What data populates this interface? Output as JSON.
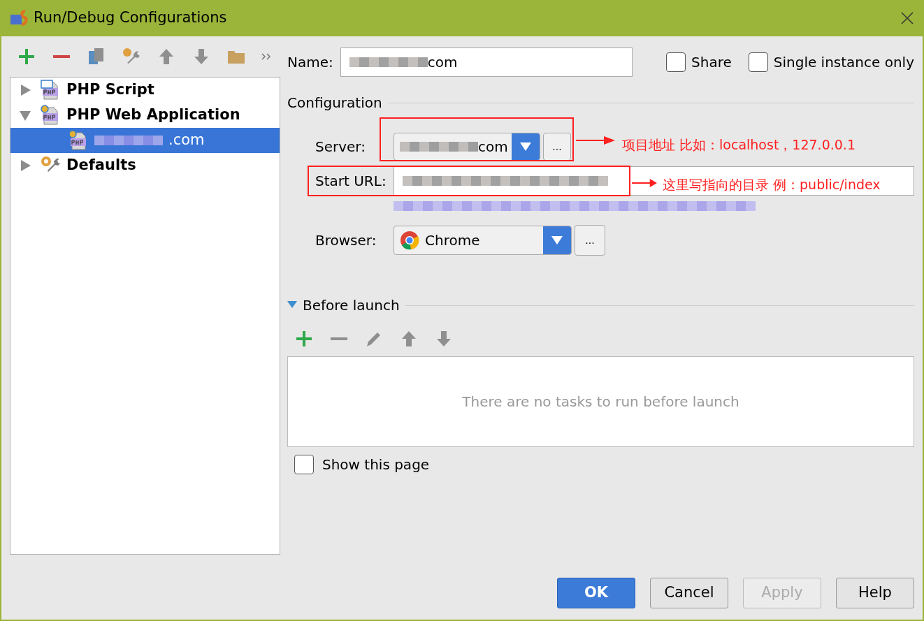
{
  "window": {
    "title": "Run/Debug Configurations"
  },
  "tree": [
    {
      "label": "PHP Script",
      "kind": "script",
      "expanded": false,
      "selected": false
    },
    {
      "label": "PHP Web Application",
      "kind": "web",
      "expanded": true,
      "selected": false,
      "children": [
        {
          "label": ".com",
          "kind": "web",
          "selected": true
        }
      ]
    },
    {
      "label": "Defaults",
      "kind": "wrench",
      "expanded": false,
      "selected": false
    }
  ],
  "name": {
    "label": "Name:",
    "value": "com"
  },
  "options": [
    {
      "label": "Share",
      "checked": false
    },
    {
      "label": "Single instance only",
      "checked": false
    }
  ],
  "configuration": {
    "title": "Configuration",
    "server": {
      "label": "Server:",
      "value": "com",
      "browse": "..."
    },
    "start_url": {
      "label": "Start URL:"
    },
    "browser": {
      "label": "Browser:",
      "value": "Chrome",
      "browse": "..."
    }
  },
  "before_launch": {
    "title": "Before launch",
    "expanded": true,
    "empty_text": "There are no tasks to run before launch"
  },
  "show_page": {
    "label": "Show this page",
    "checked": false
  },
  "buttons": [
    {
      "label": "OK",
      "kind": "default",
      "disabled": false
    },
    {
      "label": "Cancel",
      "kind": "normal",
      "disabled": false
    },
    {
      "label": "Apply",
      "kind": "normal",
      "disabled": true
    },
    {
      "label": "Help",
      "kind": "normal",
      "disabled": false
    }
  ],
  "annotations": [
    {
      "text": "项目地址 比如：localhost，127.0.0.1"
    },
    {
      "text": "这里写指向的目录 例：public/index"
    }
  ]
}
